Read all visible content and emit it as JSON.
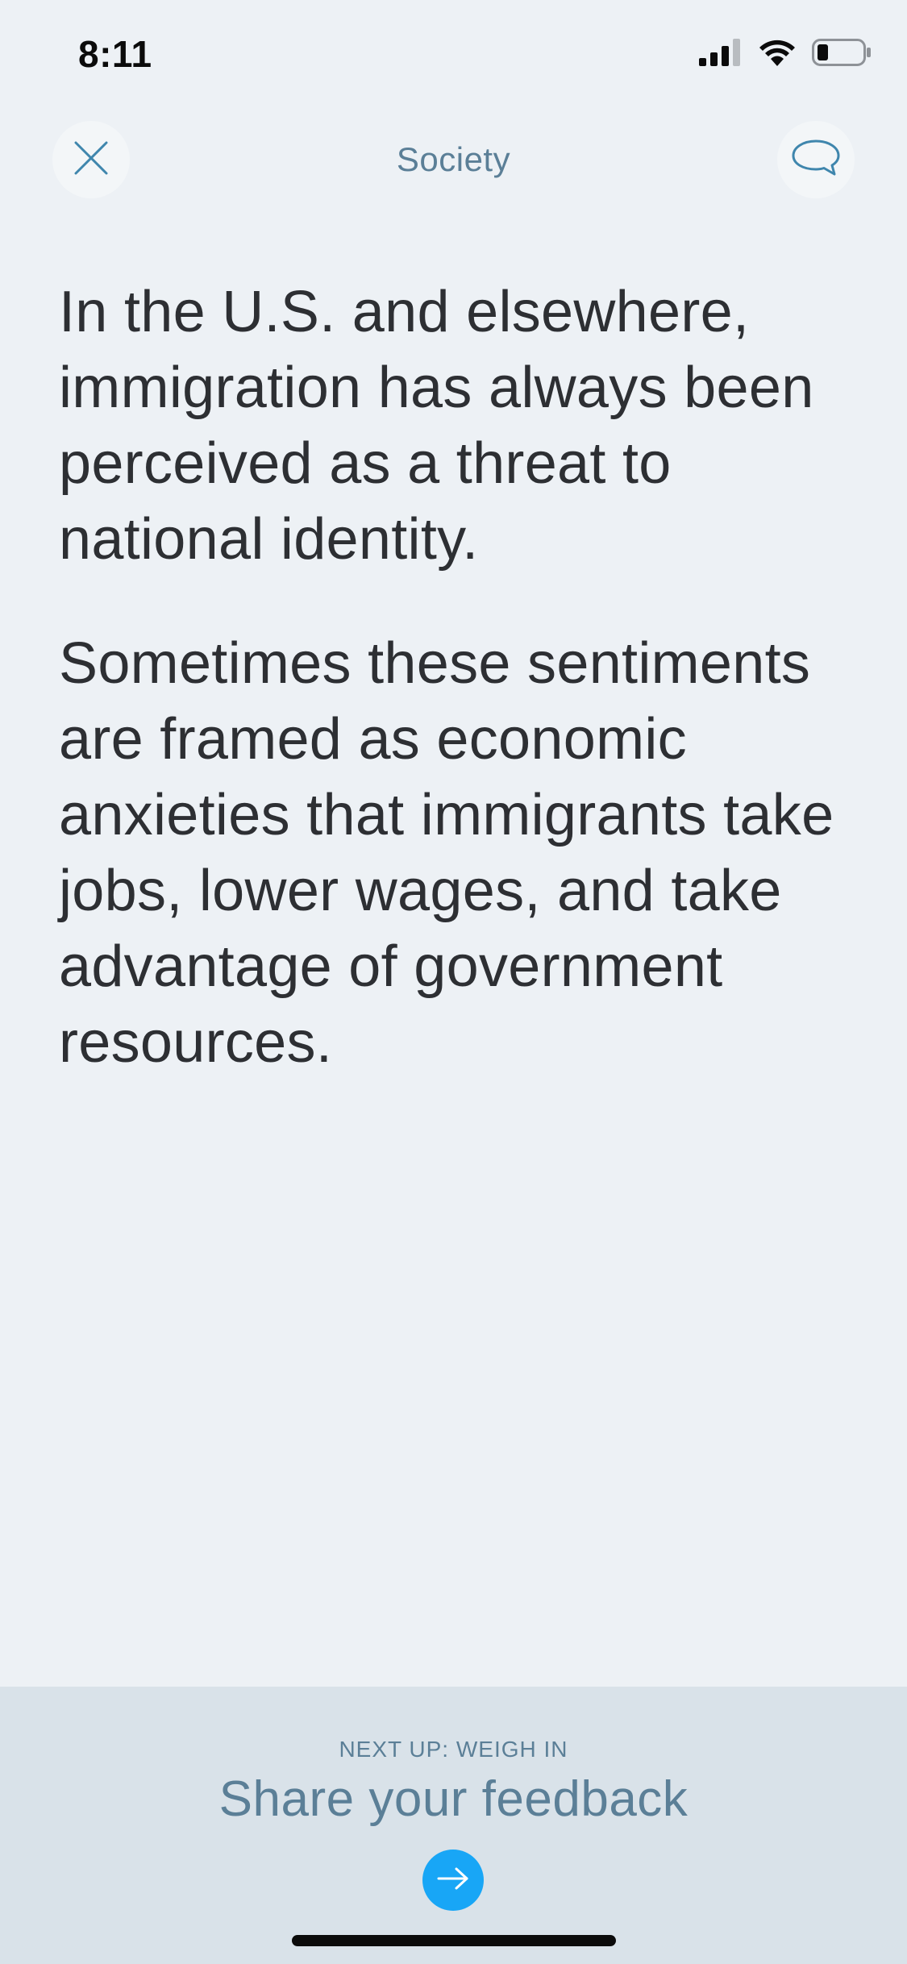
{
  "status_bar": {
    "time": "8:11",
    "icons": [
      "cellular-signal-icon",
      "wifi-icon",
      "battery-icon"
    ]
  },
  "nav": {
    "title": "Society",
    "close_icon": "close-icon",
    "comment_icon": "comment-icon"
  },
  "content": {
    "paragraphs": [
      "In the U.S. and elsewhere, immigration has always been perceived as a threat to national identity.",
      "Sometimes these sentiments are framed as economic anxieties that immigrants take jobs, lower wages, and take advantage of government resources."
    ]
  },
  "next_up": {
    "label": "NEXT UP: WEIGH IN",
    "title": "Share your feedback",
    "button_icon": "arrow-right-icon"
  },
  "colors": {
    "background": "#edf1f5",
    "text": "#2d2f33",
    "muted_blue": "#5b7f97",
    "bottom_panel": "#d9e2e9",
    "accent": "#18a6f6"
  }
}
